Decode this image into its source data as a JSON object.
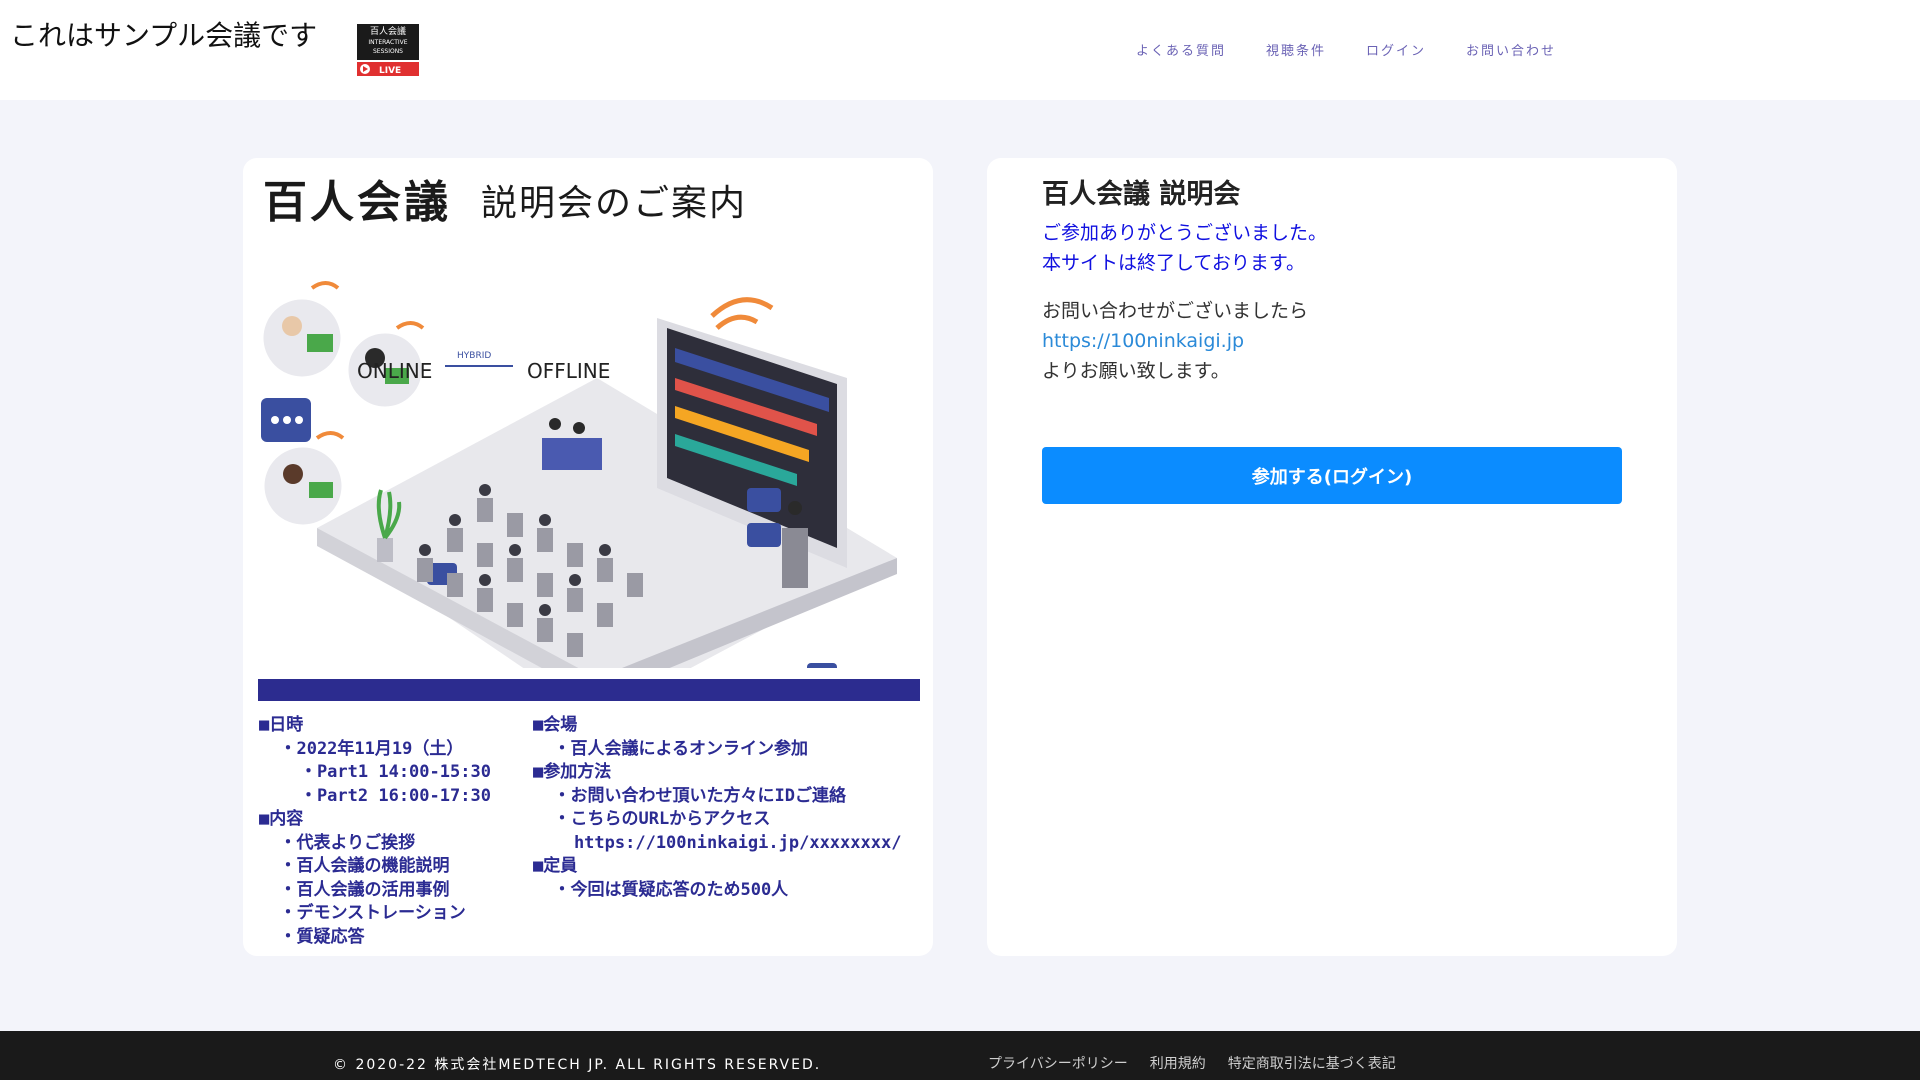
{
  "header": {
    "site_title": "これはサンプル会議です",
    "logo_text": [
      "百人会議",
      "INTERACTIVE",
      "SESSIONS",
      "LIVE"
    ],
    "nav": [
      "よくある質問",
      "視聴条件",
      "ログイン",
      "お問い合わせ"
    ]
  },
  "flyer": {
    "title": "百人会議",
    "subtitle": "説明会のご案内",
    "online_label": "ONLINE",
    "hybrid_label": "HYBRID",
    "offline_label": "OFFLINE",
    "left_lines": "■日時\n  ・2022年11月19（土）\n    ・Part1 14:00-15:30\n    ・Part2 16:00-17:30\n■内容\n  ・代表よりご挨拶\n  ・百人会議の機能説明\n  ・百人会議の活用事例\n  ・デモンストレーション\n  ・質疑応答",
    "right_lines": "■会場\n  ・百人会議によるオンライン参加\n■参加方法\n  ・お問い合わせ頂いた方々にIDご連絡\n  ・こちらのURLからアクセス\n    https://100ninkaigi.jp/xxxxxxxx/\n■定員\n  ・今回は質疑応答のため500人"
  },
  "panel": {
    "title": "百人会議 説明会",
    "thanks_1": "ご参加ありがとうございました。",
    "thanks_2": "本サイトは終了しております。",
    "contact_1": "お問い合わせがございましたら",
    "contact_link": "https://100ninkaigi.jp",
    "contact_2": "よりお願い致します。",
    "login_button": "参加する(ログイン)"
  },
  "footer": {
    "copyright": "© 2020-22 株式会社MEDTECH JP. ALL RIGHTS RESERVED.",
    "links": [
      "プライバシーポリシー",
      "利用規約",
      "特定商取引法に基づく表記"
    ]
  }
}
